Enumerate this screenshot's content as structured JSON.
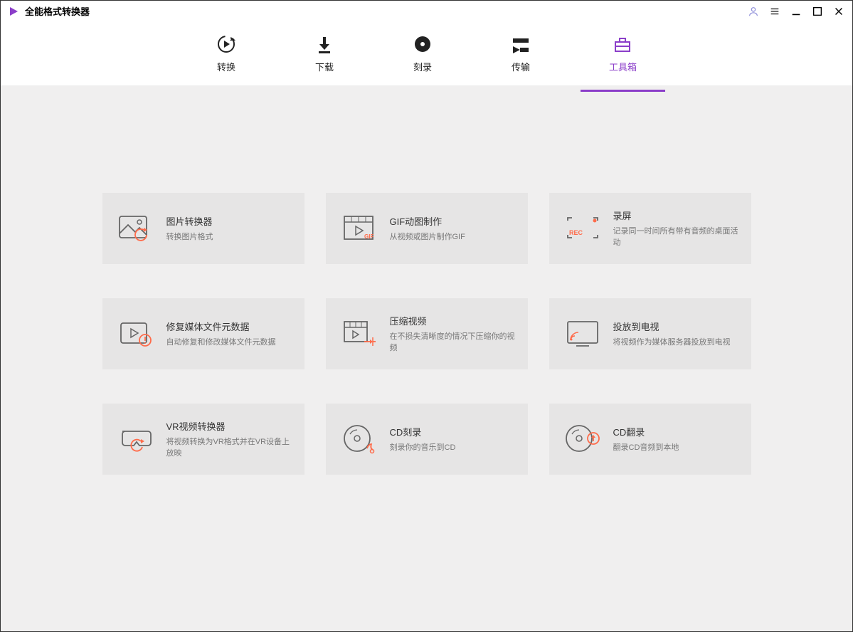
{
  "app": {
    "title": "全能格式转换器"
  },
  "nav": {
    "items": [
      {
        "label": "转换"
      },
      {
        "label": "下载"
      },
      {
        "label": "刻录"
      },
      {
        "label": "传输"
      },
      {
        "label": "工具箱"
      }
    ]
  },
  "tools": [
    {
      "title": "图片转换器",
      "desc": "转换图片格式"
    },
    {
      "title": "GIF动图制作",
      "desc": "从视频或图片制作GIF"
    },
    {
      "title": "录屏",
      "desc": "记录同一时间所有带有音频的桌面活动"
    },
    {
      "title": "修复媒体文件元数据",
      "desc": "自动修复和修改媒体文件元数据"
    },
    {
      "title": "压缩视频",
      "desc": "在不损失清晰度的情况下压缩你的视频"
    },
    {
      "title": "投放到电视",
      "desc": "将视频作为媒体服务器投放到电视"
    },
    {
      "title": "VR视频转换器",
      "desc": "将视频转换为VR格式并在VR设备上放映"
    },
    {
      "title": "CD刻录",
      "desc": "刻录你的音乐到CD"
    },
    {
      "title": "CD翻录",
      "desc": "翻录CD音频到本地"
    }
  ]
}
